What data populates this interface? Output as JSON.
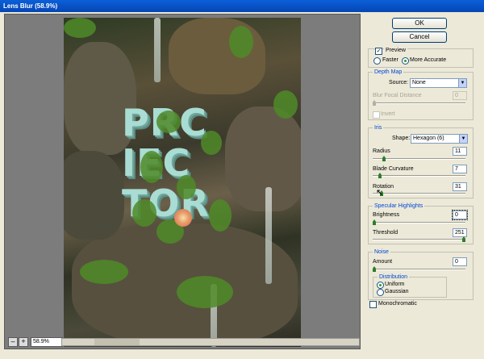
{
  "window": {
    "title": "Lens Blur (58.9%)"
  },
  "zoom": {
    "minus": "–",
    "plus": "+",
    "level": "58.9%"
  },
  "buttons": {
    "ok": "OK",
    "cancel": "Cancel"
  },
  "preview": {
    "label": "Preview",
    "checked": true,
    "faster": "Faster",
    "more_accurate": "More Accurate",
    "selected": "More Accurate"
  },
  "depth_map": {
    "legend": "Depth Map",
    "source_label": "Source:",
    "source_value": "None",
    "focal_label": "Blur Focal Distance",
    "focal_value": "0",
    "invert_label": "Invert"
  },
  "iris": {
    "legend": "Iris",
    "shape_label": "Shape:",
    "shape_value": "Hexagon (6)",
    "radius_label": "Radius",
    "radius_value": "11",
    "blade_label": "Blade Curvature",
    "blade_value": "7",
    "rotation_label": "Rotation",
    "rotation_value": "31"
  },
  "specular": {
    "legend": "Specular Highlights",
    "brightness_label": "Brightness",
    "brightness_value": "0",
    "threshold_label": "Threshold",
    "threshold_value": "251"
  },
  "noise": {
    "legend": "Noise",
    "amount_label": "Amount",
    "amount_value": "0",
    "distribution_legend": "Distribution",
    "uniform": "Uniform",
    "gaussian": "Gaussian",
    "selected": "Uniform",
    "mono_label": "Monochromatic"
  },
  "artwork": {
    "letters": [
      "PRC",
      "IEC",
      "TOR"
    ]
  },
  "colors": {
    "accent": "#0046d5",
    "titlebar": "#0b5fd8",
    "dialog_bg": "#ece9d8"
  }
}
